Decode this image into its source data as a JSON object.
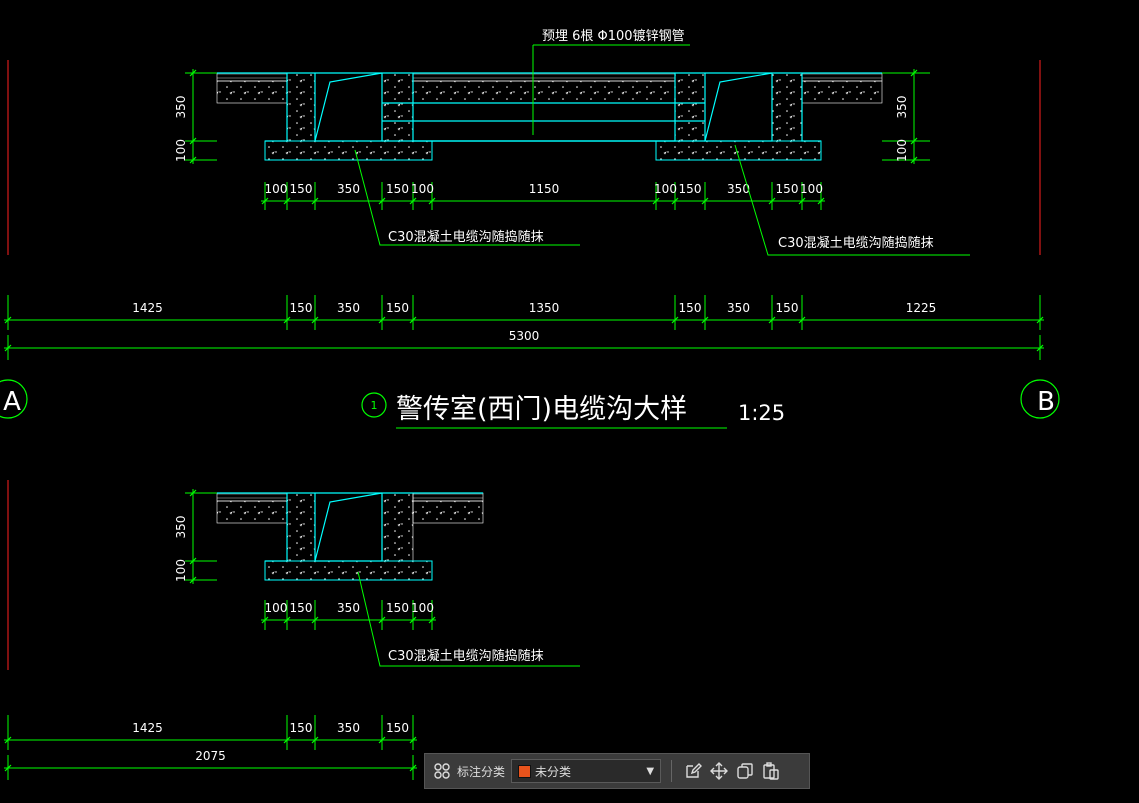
{
  "drawing": {
    "pipe_note": "预埋 6根 Φ100镀锌钢管",
    "title": "警传室(西门)电缆沟大样",
    "scale": "1:25",
    "detail_no": "1",
    "grid_a": "A",
    "grid_b": "B",
    "callout": "C30混凝土电缆沟随捣随抹",
    "dims_left_vertical": [
      "350",
      "100"
    ],
    "dims_right_vertical": [
      "350",
      "100"
    ],
    "dims_section1_small": [
      "100",
      "150",
      "350",
      "150",
      "100",
      "1150",
      "100",
      "150",
      "350",
      "150",
      "100"
    ],
    "dims_overall_row": [
      "1425",
      "150",
      "350",
      "150",
      "1350",
      "150",
      "350",
      "150",
      "1225"
    ],
    "dim_total": "5300",
    "dims_section2_small": [
      "100",
      "150",
      "350",
      "150",
      "100"
    ],
    "dims_section2_row": [
      "1425",
      "150",
      "350",
      "150"
    ],
    "dim_total2": "2075"
  },
  "toolbar": {
    "label": "标注分类",
    "selected": "未分类",
    "swatch_color": "#e8531c",
    "icons": [
      "layout-grid-icon",
      "edit-icon",
      "move-icon",
      "copy-icon",
      "paste-icon"
    ]
  },
  "colors": {
    "background": "#000000",
    "dimension": "#00ff00",
    "outline": "#00ffff",
    "text": "#ffffff",
    "axis": "#ff0000"
  }
}
